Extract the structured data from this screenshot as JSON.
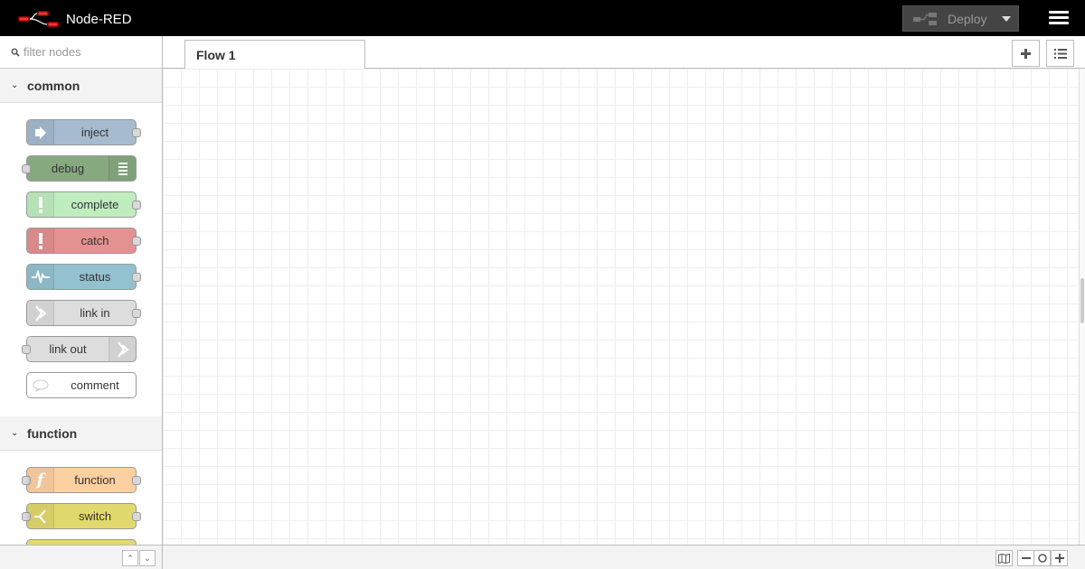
{
  "header": {
    "app_name": "Node-RED",
    "deploy_label": "Deploy",
    "bg_color": "#000000"
  },
  "palette": {
    "filter_placeholder": "filter nodes",
    "categories": [
      {
        "label": "common",
        "nodes": [
          {
            "label": "inject",
            "icon": "arrow-in-icon",
            "color": "#a6bbcf"
          },
          {
            "label": "debug",
            "icon": "list-icon",
            "color": "#87a980"
          },
          {
            "label": "complete",
            "icon": "alert-icon",
            "color": "#c0edc0"
          },
          {
            "label": "catch",
            "icon": "alert-icon",
            "color": "#e49191"
          },
          {
            "label": "status",
            "icon": "pulse-icon",
            "color": "#94c1d0"
          },
          {
            "label": "link in",
            "icon": "link-icon",
            "color": "#dddddd"
          },
          {
            "label": "link out",
            "icon": "link-icon",
            "color": "#dddddd"
          },
          {
            "label": "comment",
            "icon": "speech-bubble-icon",
            "color": "#ffffff"
          }
        ]
      },
      {
        "label": "function",
        "nodes": [
          {
            "label": "function",
            "icon": "function-icon",
            "color": "#fdd0a2"
          },
          {
            "label": "switch",
            "icon": "switch-icon",
            "color": "#e2d96e"
          }
        ]
      }
    ]
  },
  "workspace": {
    "tabs": [
      {
        "label": "Flow 1"
      }
    ]
  }
}
